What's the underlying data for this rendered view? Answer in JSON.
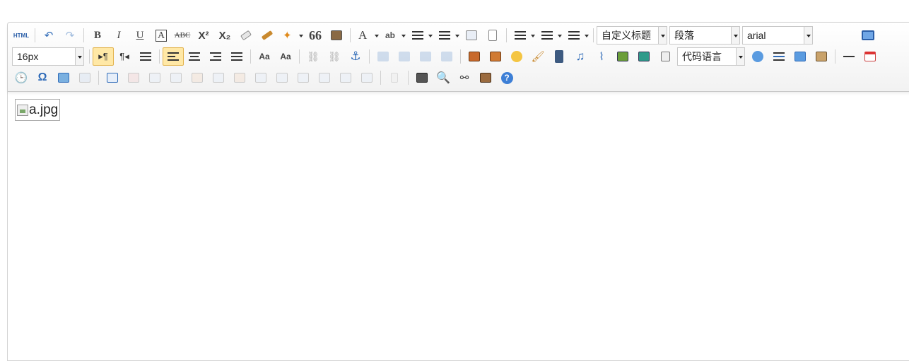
{
  "toolbar": {
    "html_label": "HTML",
    "heading_combo": "自定义标题",
    "paragraph_combo": "段落",
    "font_family_combo": "arial",
    "font_size_combo": "16px",
    "code_language_combo": "代码语言"
  },
  "editor": {
    "image_alt": "a.jpg"
  },
  "colors": {
    "accent": "#2f6bb8",
    "active_bg": "#ffe8a6",
    "active_border": "#e3b34c",
    "toolbar_border": "#c8c8c8"
  }
}
